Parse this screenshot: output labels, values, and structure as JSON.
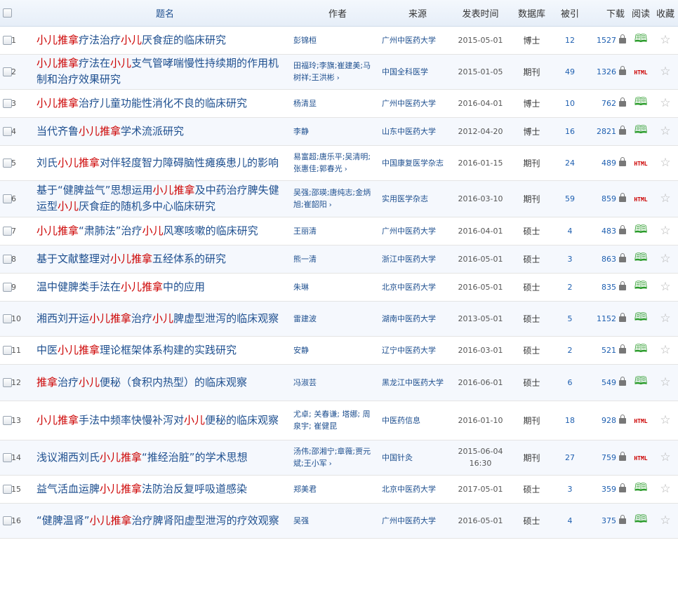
{
  "headers": {
    "title": "题名",
    "author": "作者",
    "source": "来源",
    "date": "发表时间",
    "db": "数据库",
    "cite": "被引",
    "download": "下载",
    "read": "阅读",
    "fav": "收藏"
  },
  "rows": [
    {
      "n": "1",
      "title": [
        [
          "小儿推拿",
          1
        ],
        [
          "疗法治疗",
          0
        ],
        [
          "小儿",
          1
        ],
        [
          "厌食症的临床研究",
          0
        ]
      ],
      "author": "彭锦桓",
      "source": "广州中医药大学",
      "date": "2015-05-01",
      "db": "博士",
      "cite": "12",
      "dl": "1527",
      "read": "book"
    },
    {
      "n": "2",
      "title": [
        [
          "小儿推拿",
          1
        ],
        [
          "疗法在",
          0
        ],
        [
          "小儿",
          1
        ],
        [
          "支气管哮喘慢性持续期的作用机制和治疗效果研究",
          0
        ]
      ],
      "author": "田福玲;李旗;崔建美;马树祥;王洪彬",
      "more": true,
      "source": "中国全科医学",
      "date": "2015-01-05",
      "db": "期刊",
      "cite": "49",
      "dl": "1326",
      "read": "html"
    },
    {
      "n": "3",
      "title": [
        [
          "小儿推拿",
          1
        ],
        [
          "治疗儿童功能性消化不良的临床研究",
          0
        ]
      ],
      "author": "杨清显",
      "source": "广州中医药大学",
      "date": "2016-04-01",
      "db": "博士",
      "cite": "10",
      "dl": "762",
      "read": "book"
    },
    {
      "n": "4",
      "title": [
        [
          "当代齐鲁",
          0
        ],
        [
          "小儿推拿",
          1
        ],
        [
          "学术流派研究",
          0
        ]
      ],
      "author": "李静",
      "source": "山东中医药大学",
      "date": "2012-04-20",
      "db": "博士",
      "cite": "16",
      "dl": "2821",
      "read": "book"
    },
    {
      "n": "5",
      "title": [
        [
          "刘氏",
          0
        ],
        [
          "小儿推拿",
          1
        ],
        [
          "对伴轻度智力障碍脑性瘫痪患儿的影响",
          0
        ]
      ],
      "author": "易富超;唐乐平;吴清明;张惠佳;郭春光",
      "more": true,
      "source": "中国康复医学杂志",
      "date": "2016-01-15",
      "db": "期刊",
      "cite": "24",
      "dl": "489",
      "read": "html"
    },
    {
      "n": "6",
      "title": [
        [
          "基于“健脾益气”思想运用",
          0
        ],
        [
          "小儿推拿",
          1
        ],
        [
          "及中药治疗脾失健运型",
          0
        ],
        [
          "小儿",
          1
        ],
        [
          "厌食症的随机多中心临床研究",
          0
        ]
      ],
      "author": "吴强;邵瑛;唐纯志;金炳旭;崔韶阳",
      "more": true,
      "source": "实用医学杂志",
      "date": "2016-03-10",
      "db": "期刊",
      "cite": "59",
      "dl": "859",
      "read": "html"
    },
    {
      "n": "7",
      "title": [
        [
          "小儿推拿",
          1
        ],
        [
          "“肃肺法”治疗",
          0
        ],
        [
          "小儿",
          1
        ],
        [
          "风寒咳嗽的临床研究",
          0
        ]
      ],
      "author": "王丽清",
      "source": "广州中医药大学",
      "date": "2016-04-01",
      "db": "硕士",
      "cite": "4",
      "dl": "483",
      "read": "book"
    },
    {
      "n": "8",
      "title": [
        [
          "基于文献整理对",
          0
        ],
        [
          "小儿推拿",
          1
        ],
        [
          "五经体系的研究",
          0
        ]
      ],
      "author": "熊一清",
      "source": "浙江中医药大学",
      "date": "2016-05-01",
      "db": "硕士",
      "cite": "3",
      "dl": "863",
      "read": "book"
    },
    {
      "n": "9",
      "title": [
        [
          "温中健脾类手法在",
          0
        ],
        [
          "小儿推拿",
          1
        ],
        [
          "中的应用",
          0
        ]
      ],
      "author": "朱琳",
      "source": "北京中医药大学",
      "date": "2016-05-01",
      "db": "硕士",
      "cite": "2",
      "dl": "835",
      "read": "book"
    },
    {
      "n": "10",
      "title": [
        [
          "湘西刘开运",
          0
        ],
        [
          "小儿推拿",
          1
        ],
        [
          "治疗",
          0
        ],
        [
          "小儿",
          1
        ],
        [
          "脾虚型泄泻的临床观察",
          0
        ]
      ],
      "author": "雷建波",
      "source": "湖南中医药大学",
      "date": "2013-05-01",
      "db": "硕士",
      "cite": "5",
      "dl": "1152",
      "read": "book"
    },
    {
      "n": "11",
      "title": [
        [
          "中医",
          0
        ],
        [
          "小儿推拿",
          1
        ],
        [
          "理论框架体系构建的实践研究",
          0
        ]
      ],
      "author": "安静",
      "source": "辽宁中医药大学",
      "date": "2016-03-01",
      "db": "硕士",
      "cite": "2",
      "dl": "521",
      "read": "book"
    },
    {
      "n": "12",
      "title": [
        [
          "推拿",
          1
        ],
        [
          "治疗",
          0
        ],
        [
          "小儿",
          1
        ],
        [
          "便秘（食积内热型）的临床观察",
          0
        ]
      ],
      "author": "冯淑芸",
      "source": "黑龙江中医药大学",
      "date": "2016-06-01",
      "db": "硕士",
      "cite": "6",
      "dl": "549",
      "read": "book"
    },
    {
      "n": "13",
      "title": [
        [
          "小儿推拿",
          1
        ],
        [
          "手法中频率快慢补泻对",
          0
        ],
        [
          "小儿",
          1
        ],
        [
          "便秘的临床观察",
          0
        ]
      ],
      "author": "尤卓; 关春谦; 塔娜; 周泉宇; 崔健昆",
      "source": "中医药信息",
      "date": "2016-01-10",
      "db": "期刊",
      "cite": "18",
      "dl": "928",
      "read": "html"
    },
    {
      "n": "14",
      "title": [
        [
          "浅议湘西刘氏",
          0
        ],
        [
          "小儿推拿",
          1
        ],
        [
          "“推经治脏”的学术思想",
          0
        ]
      ],
      "author": "汤伟;邵湘宁;章薇;贾元斌;王小军",
      "more": true,
      "source": "中国针灸",
      "date": "2015-06-04 16:30",
      "db": "期刊",
      "cite": "27",
      "dl": "759",
      "read": "html"
    },
    {
      "n": "15",
      "title": [
        [
          "益气活血运脾",
          0
        ],
        [
          "小儿推拿",
          1
        ],
        [
          "法防治反复呼吸道感染",
          0
        ]
      ],
      "author": "郑美君",
      "source": "北京中医药大学",
      "date": "2017-05-01",
      "db": "硕士",
      "cite": "3",
      "dl": "359",
      "read": "book"
    },
    {
      "n": "16",
      "title": [
        [
          "“健脾温肾”",
          0
        ],
        [
          "小儿推拿",
          1
        ],
        [
          "治疗脾肾阳虚型泄泻的疗效观察",
          0
        ]
      ],
      "author": "吴强",
      "source": "广州中医药大学",
      "date": "2016-05-01",
      "db": "硕士",
      "cite": "4",
      "dl": "375",
      "read": "book"
    }
  ],
  "icons": {
    "lock": "lock-icon",
    "book": "open-book-icon",
    "html": "HTML",
    "star": "star-icon",
    "more": "chevron-right-icon"
  }
}
